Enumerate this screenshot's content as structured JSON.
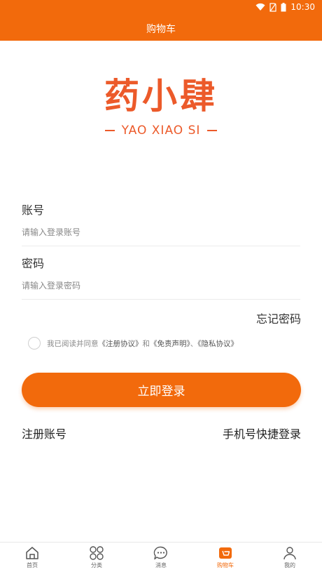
{
  "status": {
    "time": "10:30"
  },
  "header": {
    "title": "购物车"
  },
  "logo": {
    "cn": "药小肆",
    "en": "YAO XIAO SI"
  },
  "form": {
    "account_label": "账号",
    "account_placeholder": "请输入登录账号",
    "password_label": "密码",
    "password_placeholder": "请输入登录密码",
    "forgot": "忘记密码"
  },
  "agreement": {
    "prefix": "我已阅读并同意",
    "register_protocol": "《注册协议》",
    "and": "和",
    "disclaimer": "《免责声明》",
    "sep": "、",
    "privacy": "《隐私协议》"
  },
  "login_button": "立即登录",
  "links": {
    "register": "注册账号",
    "quick_login": "手机号快捷登录"
  },
  "tabs": [
    {
      "label": "首页",
      "icon": "home-icon"
    },
    {
      "label": "分类",
      "icon": "grid-icon"
    },
    {
      "label": "消息",
      "icon": "message-icon"
    },
    {
      "label": "购物车",
      "icon": "cart-icon"
    },
    {
      "label": "我的",
      "icon": "user-icon"
    }
  ],
  "colors": {
    "brand": "#f26a0c",
    "logo": "#ec5a2a"
  }
}
